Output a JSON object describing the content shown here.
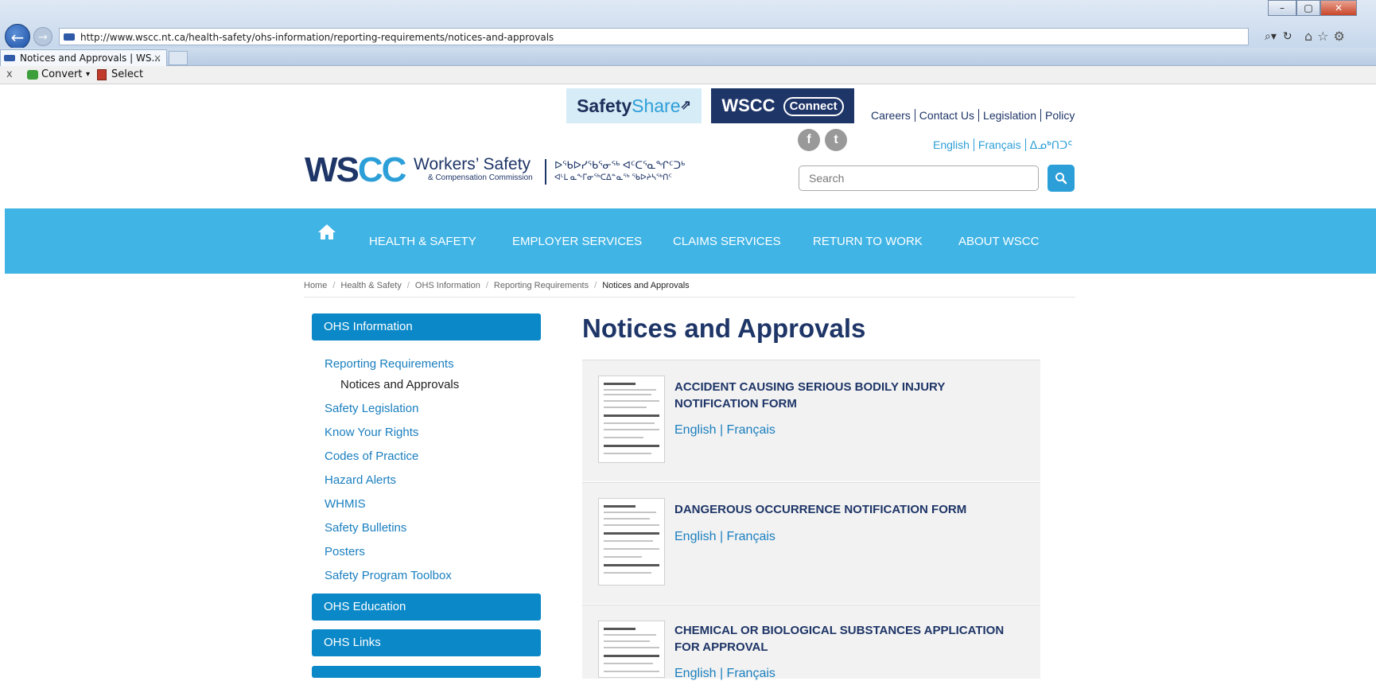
{
  "browser": {
    "url": "http://www.wscc.nt.ca/health-safety/ohs-information/reporting-requirements/notices-and-approvals",
    "tab_title": "Notices and Approvals | WS...",
    "tab_close": "×",
    "command_bar": {
      "close": "x",
      "convert_label": "Convert",
      "convert_caret": "▾",
      "select_label": "Select"
    }
  },
  "header": {
    "safetyshare_bold": "Safety",
    "safetyshare_light": "Share",
    "wscc_connect_text": "WSCC",
    "wscc_connect_pill": "Connect",
    "top_links": [
      "Careers",
      "Contact Us",
      "Legislation",
      "Policy"
    ],
    "languages": [
      "English",
      "Français",
      "ᐃᓄᒃᑎᑐᑦ"
    ],
    "social": [
      "f",
      "t"
    ],
    "search_placeholder": "Search",
    "logo": {
      "mark_ws": "WS",
      "mark_cc": "CC",
      "name": "Workers’ Safety",
      "subtitle": "& Compensation Commission",
      "syllabics_1": "ᐅᖃᐅᓯᖃᕐᓂᖅ ᐊᑦᑕᕐᓇᖏᑦᑐᒃ",
      "syllabics_2": "ᐊᒻᒪ ᓇᖕᒥᓂᖅᑕᐃᓐᓇᖅ ᖃᐅᔨᓴᖅᑎᑦ"
    }
  },
  "nav": {
    "items": [
      "HEALTH & SAFETY",
      "EMPLOYER SERVICES",
      "CLAIMS SERVICES",
      "RETURN TO WORK",
      "ABOUT WSCC"
    ]
  },
  "breadcrumb": [
    "Home",
    "Health & Safety",
    "OHS Information",
    "Reporting Requirements",
    "Notices and Approvals"
  ],
  "sidebar": {
    "section_1": "OHS Information",
    "links": [
      "Reporting Requirements",
      "Safety Legislation",
      "Know Your Rights",
      "Codes of Practice",
      "Hazard Alerts",
      "WHMIS",
      "Safety Bulletins",
      "Posters",
      "Safety Program Toolbox"
    ],
    "sub_item": "Notices and Approvals",
    "section_2": "OHS Education",
    "section_3": "OHS Links"
  },
  "main": {
    "title": "Notices and Approvals",
    "cards": [
      {
        "title": "ACCIDENT CAUSING SERIOUS BODILY INJURY NOTIFICATION FORM",
        "link_en": "English",
        "sep": "|",
        "link_fr": "Français"
      },
      {
        "title": "DANGEROUS OCCURRENCE NOTIFICATION FORM",
        "link_en": "English",
        "sep": "|",
        "link_fr": "Français"
      },
      {
        "title": "CHEMICAL OR BIOLOGICAL SUBSTANCES APPLICATION FOR APPROVAL",
        "link_en": "English",
        "sep": "|",
        "link_fr": "Français"
      }
    ]
  },
  "colors": {
    "nav_bg": "#40b4e5",
    "navy": "#1e3567",
    "link_blue": "#1a7fbf",
    "sidebar_head": "#0a88c8"
  }
}
